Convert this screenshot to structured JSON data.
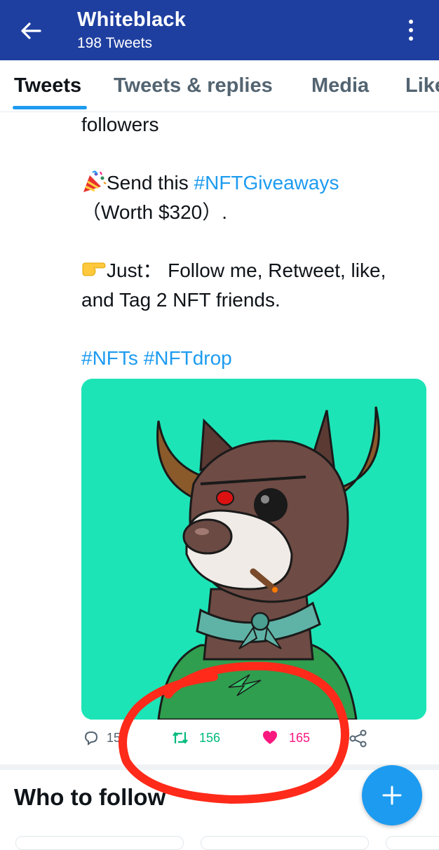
{
  "header": {
    "title": "Whiteblack",
    "subtitle": "198 Tweets"
  },
  "tabs": [
    {
      "label": "Tweets",
      "active": true
    },
    {
      "label": "Tweets & replies",
      "active": false
    },
    {
      "label": "Media",
      "active": false
    },
    {
      "label": "Likes",
      "active": false
    }
  ],
  "tweet": {
    "line_followers": "followers",
    "send_prefix": "Send this ",
    "send_hashtag": "#NFTGiveaways",
    "worth": "（Worth $320）.",
    "just_line1": "Just： Follow me, Retweet, like,",
    "just_line2": "and Tag 2 NFT  friends.",
    "hashtags": [
      "#NFTs",
      "#NFTdrop"
    ],
    "emoji_party": "party-popper",
    "emoji_point": "pointing-right-hand"
  },
  "actions": {
    "replies": "15",
    "retweets": "156",
    "likes": "165"
  },
  "who_to_follow": {
    "title": "Who to follow"
  },
  "colors": {
    "header_bg": "#1f3fa0",
    "accent": "#1d9bf0",
    "retweet": "#00ba7c",
    "like": "#f91880",
    "media_bg": "#1de4b6",
    "scribble": "#ff2a1a"
  }
}
